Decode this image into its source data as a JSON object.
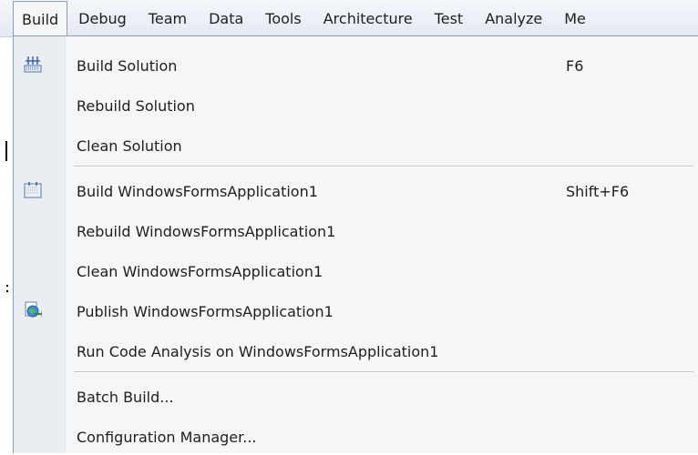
{
  "menubar": {
    "items": [
      "Build",
      "Debug",
      "Team",
      "Data",
      "Tools",
      "Architecture",
      "Test",
      "Analyze",
      "Me"
    ]
  },
  "menu": {
    "build_solution": {
      "label": "Build Solution",
      "shortcut": "F6",
      "icon": "build-icon"
    },
    "rebuild_solution": {
      "label": "Rebuild Solution"
    },
    "clean_solution": {
      "label": "Clean Solution"
    },
    "build_project": {
      "label": "Build WindowsFormsApplication1",
      "shortcut": "Shift+F6",
      "icon": "build-project-icon"
    },
    "rebuild_project": {
      "label": "Rebuild WindowsFormsApplication1"
    },
    "clean_project": {
      "label": "Clean WindowsFormsApplication1"
    },
    "publish_project": {
      "label": "Publish WindowsFormsApplication1",
      "icon": "publish-icon"
    },
    "code_analysis": {
      "label": "Run Code Analysis on WindowsFormsApplication1"
    },
    "batch_build": {
      "label": "Batch Build..."
    },
    "configuration_manager": {
      "label": "Configuration Manager..."
    }
  }
}
